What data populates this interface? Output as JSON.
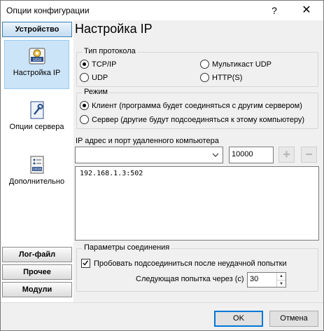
{
  "window": {
    "title": "Опции конфигурации",
    "help_glyph": "?",
    "close_glyph": "✕"
  },
  "sidebar": {
    "top_category": "Устройство",
    "items": [
      {
        "label": "Настройка IP",
        "icon": "network-settings-icon",
        "selected": true
      },
      {
        "label": "Опции сервера",
        "icon": "wrench-document-icon",
        "selected": false
      },
      {
        "label": "Дополнительно",
        "icon": "checklist-icon",
        "selected": false
      }
    ],
    "bottom_categories": [
      "Лог-файл",
      "Прочее",
      "Модули"
    ]
  },
  "page": {
    "heading": "Настройка IP"
  },
  "protocol": {
    "legend": "Тип протокола",
    "options": [
      {
        "label": "TCP/IP",
        "checked": true
      },
      {
        "label": "Мультикаст UDP",
        "checked": false
      },
      {
        "label": "UDP",
        "checked": false
      },
      {
        "label": "HTTP(S)",
        "checked": false
      }
    ]
  },
  "mode": {
    "legend": "Режим",
    "options": [
      {
        "label": "Клиент (программа будет соединяться с другим сервером)",
        "checked": true
      },
      {
        "label": "Сервер (другие будут подсоединяться к этому компьютеру)",
        "checked": false
      }
    ]
  },
  "remote": {
    "label": "IP адрес и порт удаленного компьютера",
    "address_value": "",
    "port_value": "10000",
    "add_glyph": "+",
    "remove_glyph": "−",
    "list_text": "192.168.1.3:502"
  },
  "connection": {
    "legend": "Параметры соединения",
    "retry_label": "Пробовать подсоединиться после неудачной попытки",
    "retry_checked": true,
    "next_attempt_label": "Следующая попытка через (с)",
    "next_attempt_value": "30"
  },
  "buttons": {
    "ok": "OK",
    "cancel": "Отмена"
  }
}
